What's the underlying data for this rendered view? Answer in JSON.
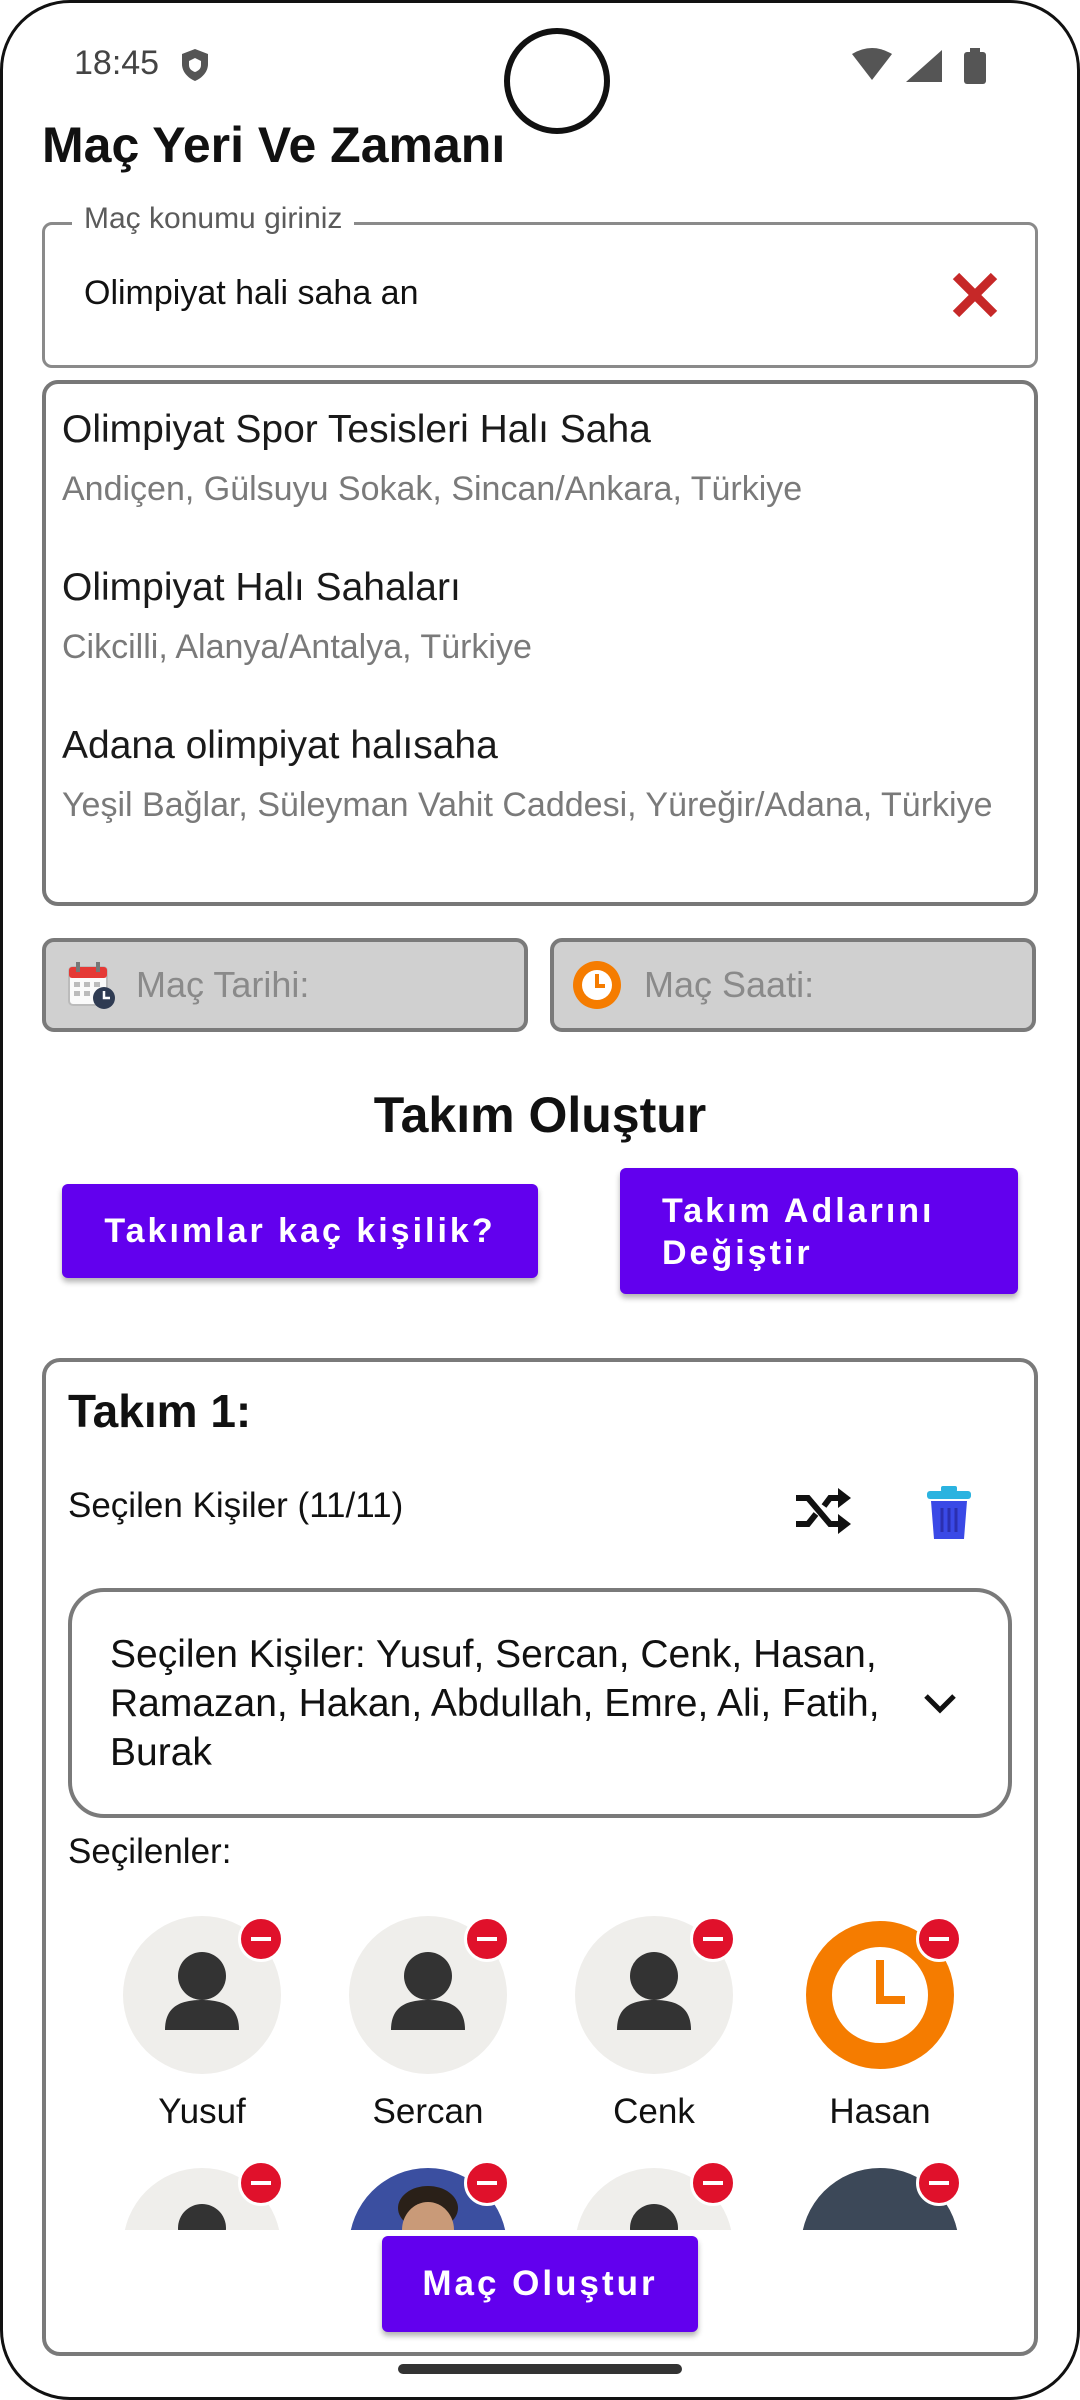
{
  "status_bar": {
    "time": "18:45"
  },
  "page": {
    "title": "Maç Yeri Ve Zamanı"
  },
  "location": {
    "legend": "Maç konumu giriniz",
    "value": "Olimpiyat hali saha an"
  },
  "suggestions": [
    {
      "title": "Olimpiyat Spor Tesisleri Halı Saha",
      "subtitle": "Andiçen, Gülsuyu Sokak, Sincan/Ankara, Türkiye"
    },
    {
      "title": "Olimpiyat Halı Sahaları",
      "subtitle": "Cikcilli, Alanya/Antalya, Türkiye"
    },
    {
      "title": "Adana olimpiyat halısaha",
      "subtitle": "Yeşil Bağlar, Süleyman Vahit Caddesi, Yüreğir/Adana, Türkiye"
    }
  ],
  "date_field": {
    "placeholder": "Maç Tarihi:"
  },
  "time_field": {
    "placeholder": "Maç Saati:"
  },
  "team_section": {
    "title": "Takım Oluştur",
    "count_button": "Takımlar kaç kişilik?",
    "rename_button": "Takım Adlarını Değiştir"
  },
  "team": {
    "title": "Takım 1:",
    "selected_count": "Seçilen Kişiler (11/11)",
    "selected_summary": "Seçilen Kişiler: Yusuf, Sercan, Cenk, Hasan, Ramazan, Hakan, Abdullah, Emre, Ali, Fatih, Burak",
    "selected_label": "Seçilenler:",
    "members": [
      {
        "name": "Yusuf",
        "avatar": "person-icon"
      },
      {
        "name": "Sercan",
        "avatar": "person-icon"
      },
      {
        "name": "Cenk",
        "avatar": "person-icon"
      },
      {
        "name": "Hasan",
        "avatar": "clock-icon"
      }
    ]
  },
  "create_button": "Maç Oluştur",
  "colors": {
    "accent": "#6200ee",
    "remove": "#e0112b",
    "clear": "#c62828",
    "orange": "#f57c00",
    "trash": "#3a49e6"
  }
}
